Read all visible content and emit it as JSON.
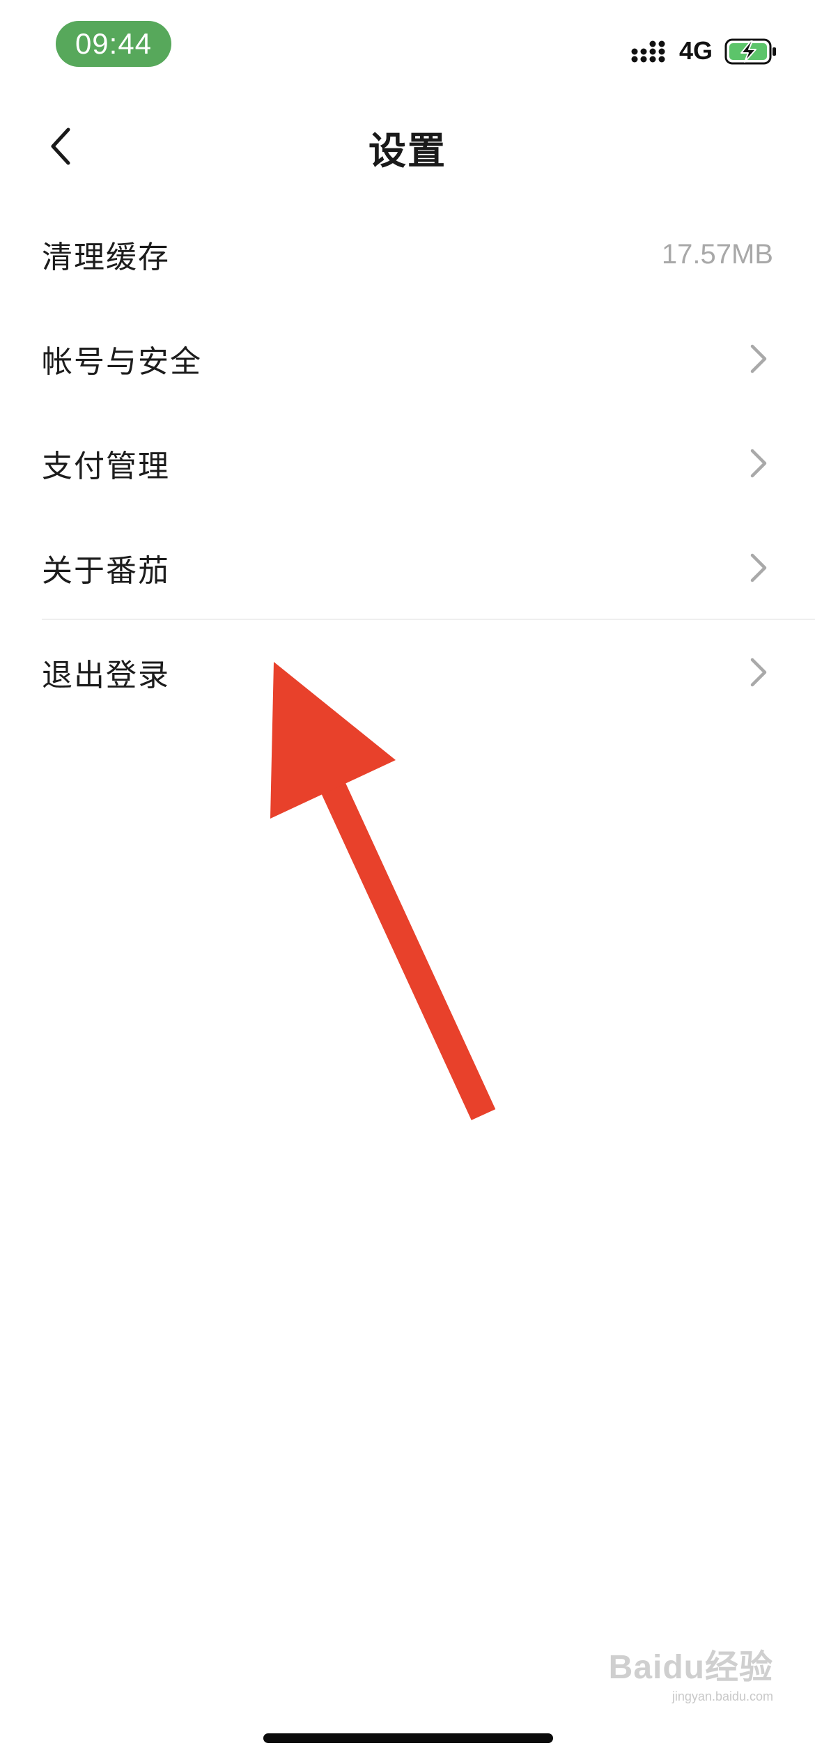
{
  "status_bar": {
    "time": "09:44",
    "network": "4G",
    "battery_color": "#5cc46a",
    "time_pill_color": "#57a85b"
  },
  "nav": {
    "title": "设置",
    "back_icon": "chevron-left-icon"
  },
  "settings": {
    "items": [
      {
        "label": "清理缓存",
        "value": "17.57MB",
        "icon": null
      },
      {
        "label": "帐号与安全",
        "value": null,
        "icon": "chevron-right-icon"
      },
      {
        "label": "支付管理",
        "value": null,
        "icon": "chevron-right-icon"
      },
      {
        "label": "关于番茄",
        "value": null,
        "icon": "chevron-right-icon"
      },
      {
        "label": "退出登录",
        "value": null,
        "icon": "chevron-right-icon"
      }
    ]
  },
  "annotation": {
    "arrow_color": "#e8412b",
    "arrow_icon": "arrow-annotation-icon"
  },
  "watermark": {
    "main": "Baidu经验",
    "sub": "jingyan.baidu.com"
  }
}
